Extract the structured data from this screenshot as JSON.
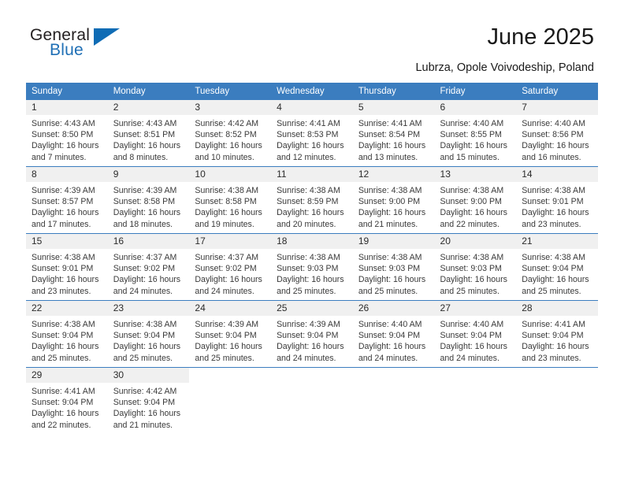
{
  "logo": {
    "word_one": "General",
    "word_two": "Blue",
    "triangle_icon": "triangle-icon",
    "accent_color": "#0f6cb5"
  },
  "header": {
    "title": "June 2025",
    "subtitle": "Lubrza, Opole Voivodeship, Poland"
  },
  "theme": {
    "header_bg": "#3b7dbf",
    "daynum_bg": "#f0f0f0",
    "rule_color": "#3b7dbf",
    "text_color": "#3a3a3a"
  },
  "weekdays": [
    "Sunday",
    "Monday",
    "Tuesday",
    "Wednesday",
    "Thursday",
    "Friday",
    "Saturday"
  ],
  "weeks": [
    [
      {
        "day": "1",
        "sunrise": "Sunrise: 4:43 AM",
        "sunset": "Sunset: 8:50 PM",
        "daylight_line1": "Daylight: 16 hours",
        "daylight_line2": "and 7 minutes."
      },
      {
        "day": "2",
        "sunrise": "Sunrise: 4:43 AM",
        "sunset": "Sunset: 8:51 PM",
        "daylight_line1": "Daylight: 16 hours",
        "daylight_line2": "and 8 minutes."
      },
      {
        "day": "3",
        "sunrise": "Sunrise: 4:42 AM",
        "sunset": "Sunset: 8:52 PM",
        "daylight_line1": "Daylight: 16 hours",
        "daylight_line2": "and 10 minutes."
      },
      {
        "day": "4",
        "sunrise": "Sunrise: 4:41 AM",
        "sunset": "Sunset: 8:53 PM",
        "daylight_line1": "Daylight: 16 hours",
        "daylight_line2": "and 12 minutes."
      },
      {
        "day": "5",
        "sunrise": "Sunrise: 4:41 AM",
        "sunset": "Sunset: 8:54 PM",
        "daylight_line1": "Daylight: 16 hours",
        "daylight_line2": "and 13 minutes."
      },
      {
        "day": "6",
        "sunrise": "Sunrise: 4:40 AM",
        "sunset": "Sunset: 8:55 PM",
        "daylight_line1": "Daylight: 16 hours",
        "daylight_line2": "and 15 minutes."
      },
      {
        "day": "7",
        "sunrise": "Sunrise: 4:40 AM",
        "sunset": "Sunset: 8:56 PM",
        "daylight_line1": "Daylight: 16 hours",
        "daylight_line2": "and 16 minutes."
      }
    ],
    [
      {
        "day": "8",
        "sunrise": "Sunrise: 4:39 AM",
        "sunset": "Sunset: 8:57 PM",
        "daylight_line1": "Daylight: 16 hours",
        "daylight_line2": "and 17 minutes."
      },
      {
        "day": "9",
        "sunrise": "Sunrise: 4:39 AM",
        "sunset": "Sunset: 8:58 PM",
        "daylight_line1": "Daylight: 16 hours",
        "daylight_line2": "and 18 minutes."
      },
      {
        "day": "10",
        "sunrise": "Sunrise: 4:38 AM",
        "sunset": "Sunset: 8:58 PM",
        "daylight_line1": "Daylight: 16 hours",
        "daylight_line2": "and 19 minutes."
      },
      {
        "day": "11",
        "sunrise": "Sunrise: 4:38 AM",
        "sunset": "Sunset: 8:59 PM",
        "daylight_line1": "Daylight: 16 hours",
        "daylight_line2": "and 20 minutes."
      },
      {
        "day": "12",
        "sunrise": "Sunrise: 4:38 AM",
        "sunset": "Sunset: 9:00 PM",
        "daylight_line1": "Daylight: 16 hours",
        "daylight_line2": "and 21 minutes."
      },
      {
        "day": "13",
        "sunrise": "Sunrise: 4:38 AM",
        "sunset": "Sunset: 9:00 PM",
        "daylight_line1": "Daylight: 16 hours",
        "daylight_line2": "and 22 minutes."
      },
      {
        "day": "14",
        "sunrise": "Sunrise: 4:38 AM",
        "sunset": "Sunset: 9:01 PM",
        "daylight_line1": "Daylight: 16 hours",
        "daylight_line2": "and 23 minutes."
      }
    ],
    [
      {
        "day": "15",
        "sunrise": "Sunrise: 4:38 AM",
        "sunset": "Sunset: 9:01 PM",
        "daylight_line1": "Daylight: 16 hours",
        "daylight_line2": "and 23 minutes."
      },
      {
        "day": "16",
        "sunrise": "Sunrise: 4:37 AM",
        "sunset": "Sunset: 9:02 PM",
        "daylight_line1": "Daylight: 16 hours",
        "daylight_line2": "and 24 minutes."
      },
      {
        "day": "17",
        "sunrise": "Sunrise: 4:37 AM",
        "sunset": "Sunset: 9:02 PM",
        "daylight_line1": "Daylight: 16 hours",
        "daylight_line2": "and 24 minutes."
      },
      {
        "day": "18",
        "sunrise": "Sunrise: 4:38 AM",
        "sunset": "Sunset: 9:03 PM",
        "daylight_line1": "Daylight: 16 hours",
        "daylight_line2": "and 25 minutes."
      },
      {
        "day": "19",
        "sunrise": "Sunrise: 4:38 AM",
        "sunset": "Sunset: 9:03 PM",
        "daylight_line1": "Daylight: 16 hours",
        "daylight_line2": "and 25 minutes."
      },
      {
        "day": "20",
        "sunrise": "Sunrise: 4:38 AM",
        "sunset": "Sunset: 9:03 PM",
        "daylight_line1": "Daylight: 16 hours",
        "daylight_line2": "and 25 minutes."
      },
      {
        "day": "21",
        "sunrise": "Sunrise: 4:38 AM",
        "sunset": "Sunset: 9:04 PM",
        "daylight_line1": "Daylight: 16 hours",
        "daylight_line2": "and 25 minutes."
      }
    ],
    [
      {
        "day": "22",
        "sunrise": "Sunrise: 4:38 AM",
        "sunset": "Sunset: 9:04 PM",
        "daylight_line1": "Daylight: 16 hours",
        "daylight_line2": "and 25 minutes."
      },
      {
        "day": "23",
        "sunrise": "Sunrise: 4:38 AM",
        "sunset": "Sunset: 9:04 PM",
        "daylight_line1": "Daylight: 16 hours",
        "daylight_line2": "and 25 minutes."
      },
      {
        "day": "24",
        "sunrise": "Sunrise: 4:39 AM",
        "sunset": "Sunset: 9:04 PM",
        "daylight_line1": "Daylight: 16 hours",
        "daylight_line2": "and 25 minutes."
      },
      {
        "day": "25",
        "sunrise": "Sunrise: 4:39 AM",
        "sunset": "Sunset: 9:04 PM",
        "daylight_line1": "Daylight: 16 hours",
        "daylight_line2": "and 24 minutes."
      },
      {
        "day": "26",
        "sunrise": "Sunrise: 4:40 AM",
        "sunset": "Sunset: 9:04 PM",
        "daylight_line1": "Daylight: 16 hours",
        "daylight_line2": "and 24 minutes."
      },
      {
        "day": "27",
        "sunrise": "Sunrise: 4:40 AM",
        "sunset": "Sunset: 9:04 PM",
        "daylight_line1": "Daylight: 16 hours",
        "daylight_line2": "and 24 minutes."
      },
      {
        "day": "28",
        "sunrise": "Sunrise: 4:41 AM",
        "sunset": "Sunset: 9:04 PM",
        "daylight_line1": "Daylight: 16 hours",
        "daylight_line2": "and 23 minutes."
      }
    ],
    [
      {
        "day": "29",
        "sunrise": "Sunrise: 4:41 AM",
        "sunset": "Sunset: 9:04 PM",
        "daylight_line1": "Daylight: 16 hours",
        "daylight_line2": "and 22 minutes."
      },
      {
        "day": "30",
        "sunrise": "Sunrise: 4:42 AM",
        "sunset": "Sunset: 9:04 PM",
        "daylight_line1": "Daylight: 16 hours",
        "daylight_line2": "and 21 minutes."
      },
      {
        "day": "",
        "sunrise": "",
        "sunset": "",
        "daylight_line1": "",
        "daylight_line2": ""
      },
      {
        "day": "",
        "sunrise": "",
        "sunset": "",
        "daylight_line1": "",
        "daylight_line2": ""
      },
      {
        "day": "",
        "sunrise": "",
        "sunset": "",
        "daylight_line1": "",
        "daylight_line2": ""
      },
      {
        "day": "",
        "sunrise": "",
        "sunset": "",
        "daylight_line1": "",
        "daylight_line2": ""
      },
      {
        "day": "",
        "sunrise": "",
        "sunset": "",
        "daylight_line1": "",
        "daylight_line2": ""
      }
    ]
  ]
}
